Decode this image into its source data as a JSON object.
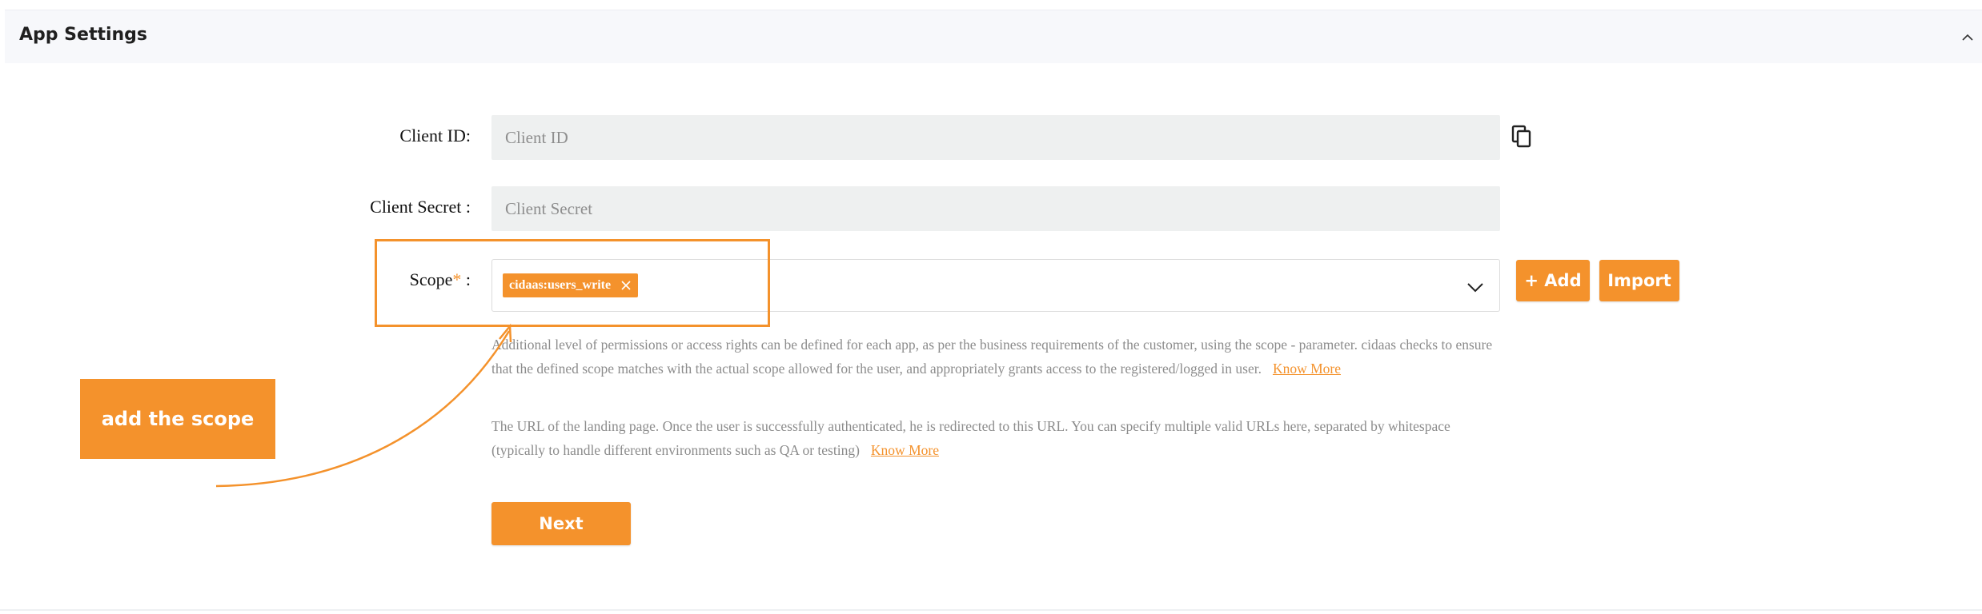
{
  "header": {
    "title": "App Settings"
  },
  "form": {
    "client_id": {
      "label": "Client ID:",
      "placeholder": "Client ID"
    },
    "client_secret": {
      "label": "Client Secret :",
      "placeholder": "Client Secret"
    },
    "scope": {
      "label": "Scope",
      "required_mark": "*",
      "label_suffix": " :",
      "chips": [
        "cidaas:users_write"
      ],
      "help_text": "Additional level of permissions or access rights can be defined for each app, as per the business requirements of the customer, using the scope - parameter. cidaas checks to ensure that the defined scope matches with the actual scope allowed for the user, and appropriately grants access to the registered/logged in user.",
      "help_link": "Know More"
    },
    "add_button": "+ Add",
    "import_button": "Import",
    "redirect_help": {
      "text": "The URL of the landing page. Once the user is successfully authenticated, he is redirected to this URL. You can specify multiple valid URLs here, separated by whitespace (typically to handle different environments such as QA or testing)",
      "link": "Know More"
    },
    "next_button": "Next"
  },
  "annotation": {
    "callout_text": "add the scope"
  },
  "colors": {
    "accent": "#f4922c",
    "header_bg": "#f7f8fb",
    "input_bg": "#eef0f0"
  },
  "icons": [
    "chevron-up-icon",
    "copy-icon",
    "close-icon",
    "chevron-down-icon"
  ]
}
